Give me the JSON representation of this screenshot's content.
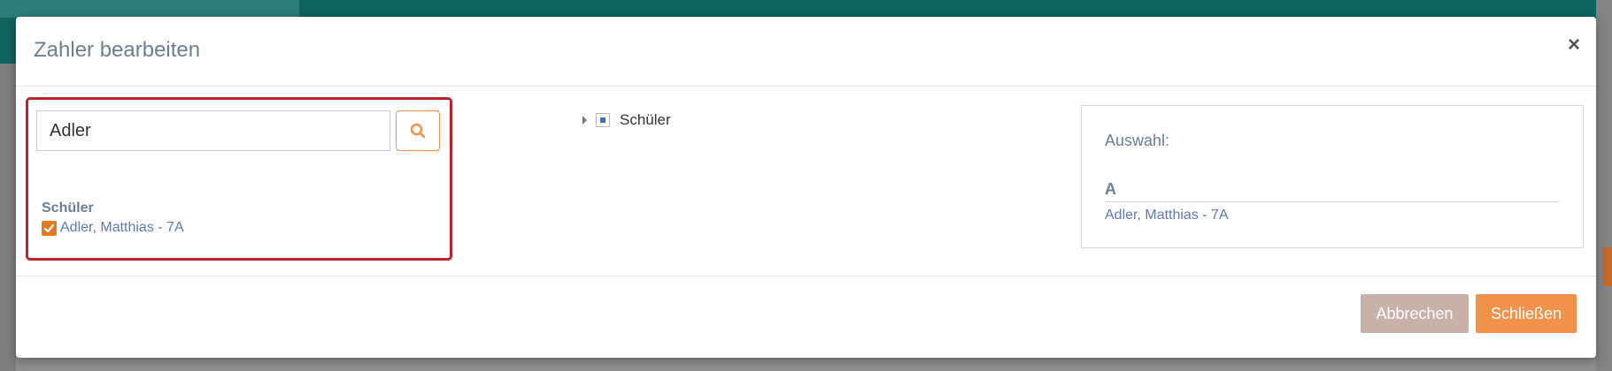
{
  "modal": {
    "title": "Zahler bearbeiten",
    "close_symbol": "×"
  },
  "search": {
    "value": "Adler",
    "button_icon": "search-icon"
  },
  "results": {
    "group_label": "Schüler",
    "items": [
      {
        "label": "Adler, Matthias - 7A",
        "checked": true
      }
    ]
  },
  "tree": {
    "label": "Schüler",
    "state": "partial"
  },
  "selection": {
    "heading": "Auswahl:",
    "letter": "A",
    "items": [
      "Adler, Matthias - 7A"
    ]
  },
  "footer": {
    "cancel_label": "Abbrechen",
    "close_label": "Schließen"
  },
  "colors": {
    "accent_orange": "#f2924a",
    "checkbox_orange": "#e07b22",
    "highlight_red": "#b8232c",
    "header_teal": "#0f6460",
    "link_blue": "#5f78b8"
  }
}
